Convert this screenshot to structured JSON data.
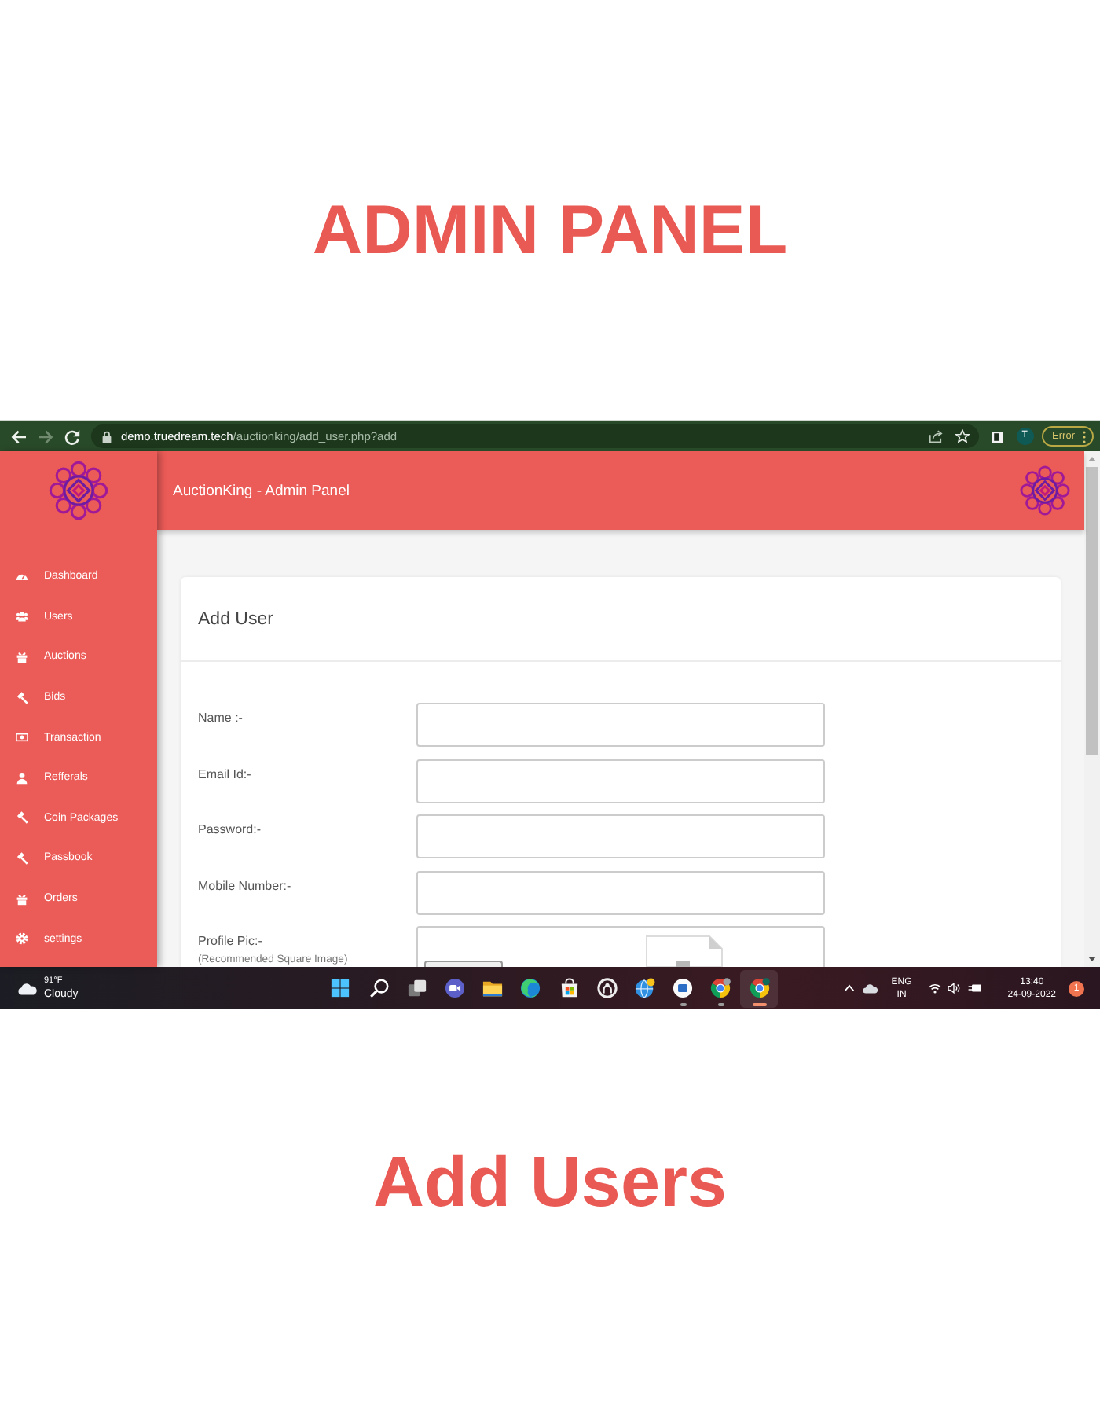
{
  "headline": "ADMIN PANEL",
  "browser": {
    "nav_buttons": [
      {
        "kind": "back",
        "disabled": false
      },
      {
        "kind": "forward",
        "disabled": true
      },
      {
        "kind": "reload",
        "disabled": false
      }
    ],
    "url_host": "demo.truedream.tech",
    "url_path": "/auctionking/add_user.php?add",
    "profile_initial": "T",
    "status_chip": "Error"
  },
  "app": {
    "title": "AuctionKing - Admin Panel"
  },
  "sidebar": {
    "items": [
      {
        "label": "Dashboard",
        "kind": "gauge"
      },
      {
        "label": "Users",
        "kind": "group"
      },
      {
        "label": "Auctions",
        "kind": "gift"
      },
      {
        "label": "Bids",
        "kind": "gavel"
      },
      {
        "label": "Transaction",
        "kind": "banknote"
      },
      {
        "label": "Refferals",
        "kind": "person"
      },
      {
        "label": "Coin Packages",
        "kind": "gavel"
      },
      {
        "label": "Passbook",
        "kind": "gavel"
      },
      {
        "label": "Orders",
        "kind": "gift"
      },
      {
        "label": "settings",
        "kind": "gear"
      }
    ]
  },
  "form": {
    "title": "Add User",
    "fields": [
      {
        "label": "Name :-",
        "kind": "text"
      },
      {
        "label": "Email Id:-",
        "kind": "text"
      },
      {
        "label": "Password:-",
        "kind": "text"
      },
      {
        "label": "Mobile Number:-",
        "kind": "text"
      },
      {
        "label": "Profile Pic:-",
        "hint": "(Recommended Square Image)",
        "kind": "file"
      }
    ]
  },
  "taskbar": {
    "weather": {
      "temperature": "91°F",
      "condition": "Cloudy"
    },
    "apps": [
      {
        "kind": "start",
        "open": false,
        "selected": false
      },
      {
        "kind": "search",
        "open": false,
        "selected": false
      },
      {
        "kind": "taskview",
        "open": false,
        "selected": false
      },
      {
        "kind": "videochat",
        "open": false,
        "selected": false
      },
      {
        "kind": "folder",
        "open": false,
        "selected": false
      },
      {
        "kind": "swirl",
        "open": false,
        "selected": false
      },
      {
        "kind": "bag",
        "open": false,
        "selected": false
      },
      {
        "kind": "ring",
        "open": false,
        "selected": false
      },
      {
        "kind": "globe",
        "open": false,
        "selected": false
      },
      {
        "kind": "disc",
        "open": true,
        "selected": false
      },
      {
        "kind": "browser",
        "open": true,
        "selected": false,
        "color": "#9aa0a6"
      },
      {
        "kind": "browser",
        "open": true,
        "selected": true,
        "color": "#0f6b5c"
      }
    ],
    "tray": {
      "language": "ENG",
      "region": "IN",
      "time": "13:40",
      "date": "24-09-2022",
      "notifications": "1"
    }
  },
  "caption": "Add Users"
}
